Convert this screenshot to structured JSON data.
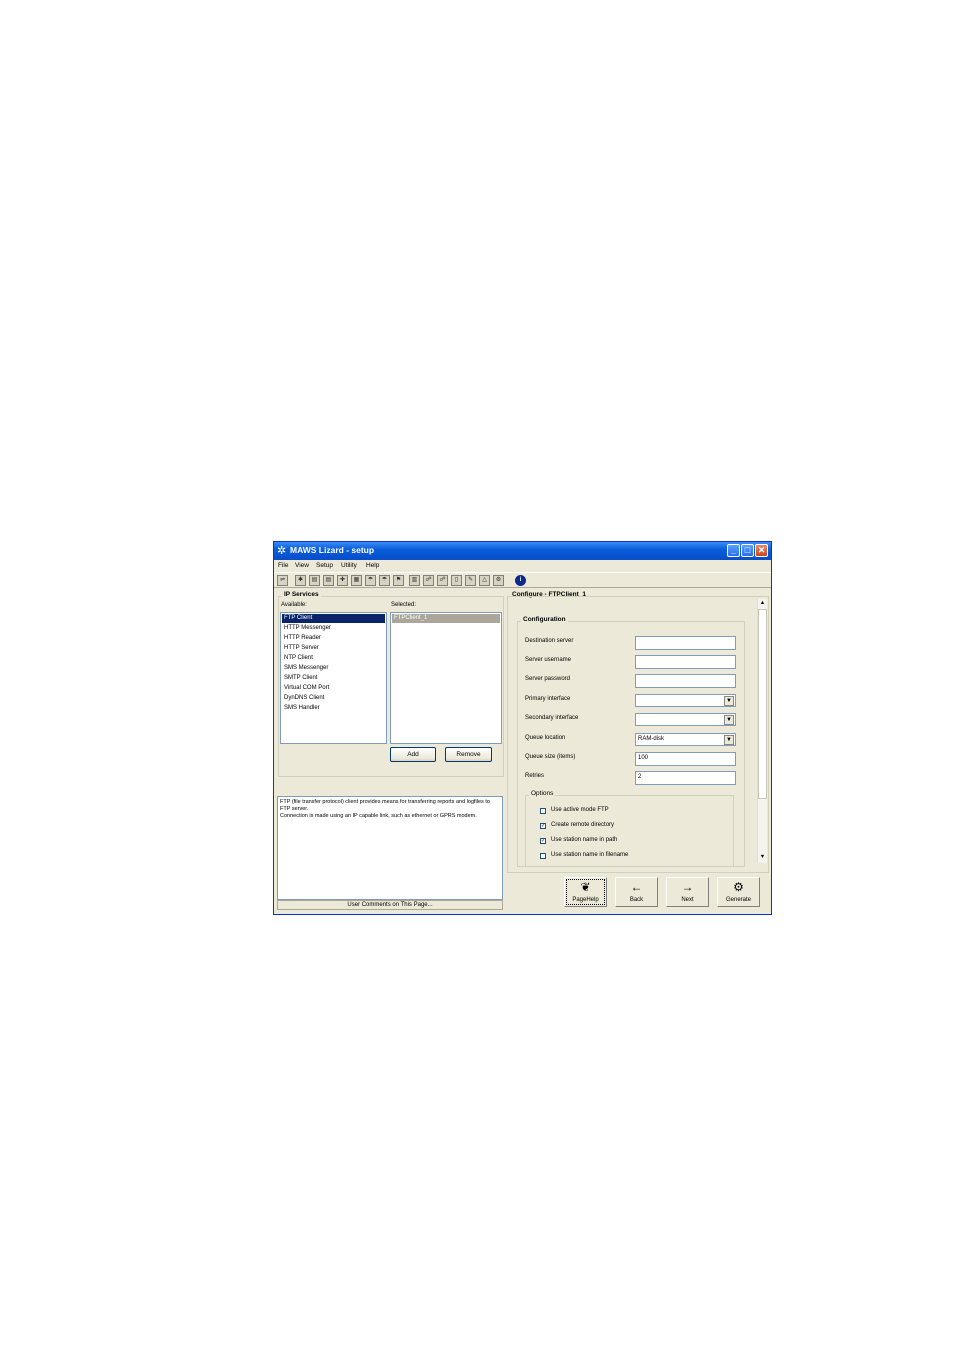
{
  "window": {
    "title": "MAWS Lizard - setup",
    "icon": "lizard-icon"
  },
  "menu": [
    "File",
    "View",
    "Setup",
    "Utility",
    "Help"
  ],
  "toolbar": {
    "icons": [
      "open-icon",
      "chip-icon",
      "ddc-icon",
      "ddc2-icon",
      "sensor-icon",
      "display-icon",
      "figure-icon",
      "figure2-icon",
      "flag-icon",
      "calc-icon",
      "network-icon",
      "network2-icon",
      "document-icon",
      "pencil-icon",
      "bell-icon",
      "gear-icon",
      "info-icon"
    ]
  },
  "ip_services": {
    "title": "IP Services",
    "available_label": "Available:",
    "selected_label": "Selected:",
    "available": [
      "FTP Client",
      "HTTP Messenger",
      "HTTP Reader",
      "HTTP Server",
      "NTP Client",
      "SMS Messenger",
      "SMTP Client",
      "Virtual COM Port",
      "DynDNS Client",
      "SMS Handler"
    ],
    "selected": [
      "FTPClient_1"
    ],
    "add_label": "Add",
    "remove_label": "Remove"
  },
  "description": {
    "line1": "FTP (file transfer protocol) client provides means for transferring reports and logfiles to FTP server.",
    "line2": "Connection is made using an IP capable link, such as ethernet or GPRS modem.",
    "comments_label": "User Comments on This Page..."
  },
  "configure": {
    "title": "Configure - FTPClient_1",
    "group_title": "Configuration",
    "fields": {
      "destination_server": {
        "label": "Destination server",
        "value": ""
      },
      "server_username": {
        "label": "Server username",
        "value": ""
      },
      "server_password": {
        "label": "Server password",
        "value": ""
      },
      "primary_interface": {
        "label": "Primary interface",
        "value": ""
      },
      "secondary_interface": {
        "label": "Secondary interface",
        "value": ""
      },
      "queue_location": {
        "label": "Queue location",
        "value": "RAM-disk"
      },
      "queue_size": {
        "label": "Queue size (items)",
        "value": "100"
      },
      "retries": {
        "label": "Retries",
        "value": "2"
      }
    },
    "options_title": "Options",
    "options": [
      {
        "label": "Use active mode FTP",
        "checked": false
      },
      {
        "label": "Create remote directory",
        "checked": true
      },
      {
        "label": "Use station name in path",
        "checked": true
      },
      {
        "label": "Use station name in filename",
        "checked": false
      }
    ]
  },
  "nav": {
    "pagehelp": "PageHelp",
    "back": "Back",
    "next": "Next",
    "generate": "Generate"
  }
}
